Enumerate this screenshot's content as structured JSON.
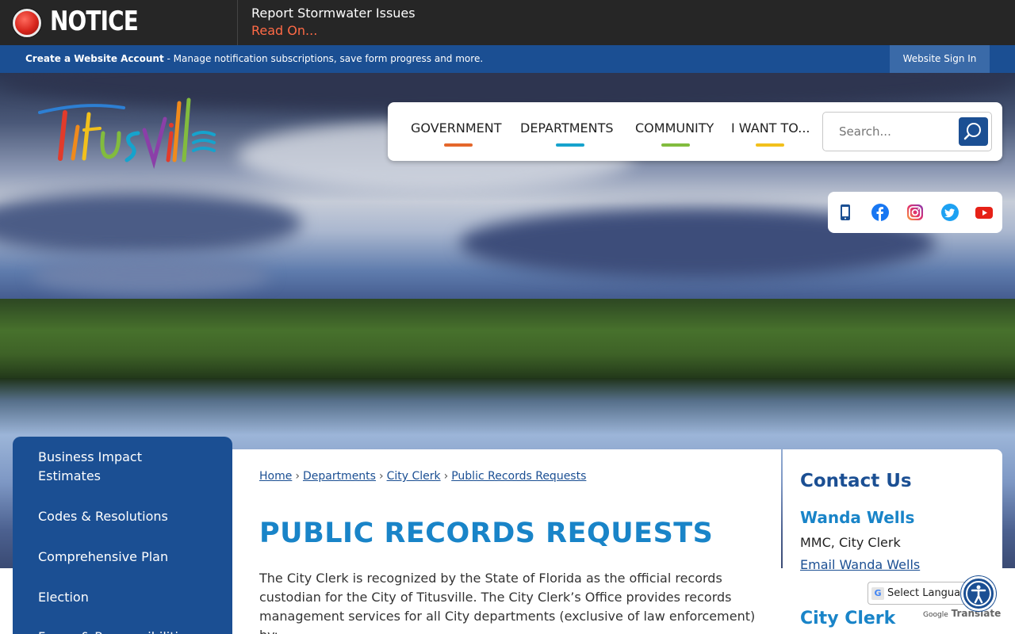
{
  "notice": {
    "title": "NOTICE",
    "message": "Report Stormwater Issues",
    "link": "Read On..."
  },
  "account_bar": {
    "create_label": "Create a Website Account",
    "description": " - Manage notification subscriptions, save form progress and more.",
    "signin_label": "Website Sign In"
  },
  "logo": {
    "text": "Titusville"
  },
  "nav": {
    "items": [
      {
        "label": "GOVERNMENT",
        "color": "#e4672b"
      },
      {
        "label": "DEPARTMENTS",
        "color": "#16a3cd"
      },
      {
        "label": "COMMUNITY",
        "color": "#82bc3e"
      },
      {
        "label": "I WANT TO...",
        "color": "#f2c01c"
      }
    ]
  },
  "search": {
    "placeholder": "Search..."
  },
  "social": {
    "icons": [
      "mobile-phone-icon",
      "facebook-icon",
      "instagram-icon",
      "twitter-icon",
      "youtube-icon"
    ]
  },
  "sidebar": {
    "items": [
      {
        "label": "Business Impact Estimates"
      },
      {
        "label": "Codes & Resolutions"
      },
      {
        "label": "Comprehensive Plan"
      },
      {
        "label": "Election"
      },
      {
        "label": "Forms & Responsibilities"
      }
    ]
  },
  "breadcrumb": {
    "items": [
      "Home",
      "Departments",
      "City Clerk",
      "Public Records Requests"
    ],
    "separator": "›"
  },
  "main": {
    "title": "PUBLIC RECORDS REQUESTS",
    "paragraph": "The City Clerk is recognized by the State of Florida as the official records custodian for the City of Titusville. The City Clerk’s Office provides records management services for all City departments (exclusive of law enforcement) by:"
  },
  "contact": {
    "heading": "Contact Us",
    "name": "Wanda Wells",
    "role": "MMC, City Clerk",
    "email_label": "Email Wanda Wells",
    "department": "City Clerk"
  },
  "translate": {
    "select_label": "Select Language",
    "powered_by": "Google",
    "translate_label": "Translate"
  },
  "colors": {
    "brand_blue": "#1b4f93",
    "title_blue": "#1984c8",
    "notice_link": "#ff6a46"
  }
}
